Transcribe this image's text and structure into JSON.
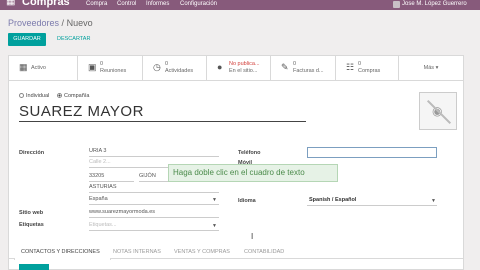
{
  "topbar": {
    "app_name": "Compras",
    "menu": [
      "Compra",
      "Control",
      "Informes",
      "Configuración"
    ],
    "user": "Jose M. López Guerrero"
  },
  "breadcrumb": {
    "parent": "Proveedores",
    "separator": "/",
    "current": "Nuevo"
  },
  "actions": {
    "save": "GUARDAR",
    "discard": "DESCARTAR"
  },
  "stat_buttons": [
    {
      "icon": "archive-icon",
      "line1": "Activo",
      "line2": ""
    },
    {
      "icon": "calendar-icon",
      "line1": "0",
      "line2": "Reuniones"
    },
    {
      "icon": "clock-icon",
      "line1": "0",
      "line2": "Actividades"
    },
    {
      "icon": "globe-icon",
      "line1": "No publica...",
      "line2": "En el sitio..."
    },
    {
      "icon": "pencil-icon",
      "line1": "0",
      "line2": "Facturas d..."
    },
    {
      "icon": "cart-icon",
      "line1": "0",
      "line2": "Compras"
    },
    {
      "icon": "",
      "line1": "Más ▾",
      "line2": ""
    }
  ],
  "company_type": {
    "individual": "Individual",
    "company": "Compañía"
  },
  "partner_name": "SUAREZ MAYOR",
  "address": {
    "label": "Dirección",
    "street": "URIA 3",
    "street2_placeholder": "Calle 2...",
    "zip": "33205",
    "city": "GIJÓN",
    "state": "ASTURIAS",
    "country": "España"
  },
  "website": {
    "label": "Sitio web",
    "value": "www.suarezmayormoda.es"
  },
  "tags": {
    "label": "Etiquetas",
    "placeholder": "Etiquetas..."
  },
  "phone": {
    "label": "Teléfono",
    "label2": "Móvil"
  },
  "language": {
    "label": "Idioma",
    "value": "Spanish / Español"
  },
  "tooltip": "Haga doble clic en el cuadro de texto",
  "tabs": [
    "CONTACTOS Y DIRECCIONES",
    "NOTAS INTERNAS",
    "VENTAS Y COMPRAS",
    "CONTABILIDAD"
  ],
  "colors": {
    "brand": "#875a7b",
    "primary": "#00a09d",
    "link": "#7c7bad",
    "alert": "#d23f3a"
  }
}
